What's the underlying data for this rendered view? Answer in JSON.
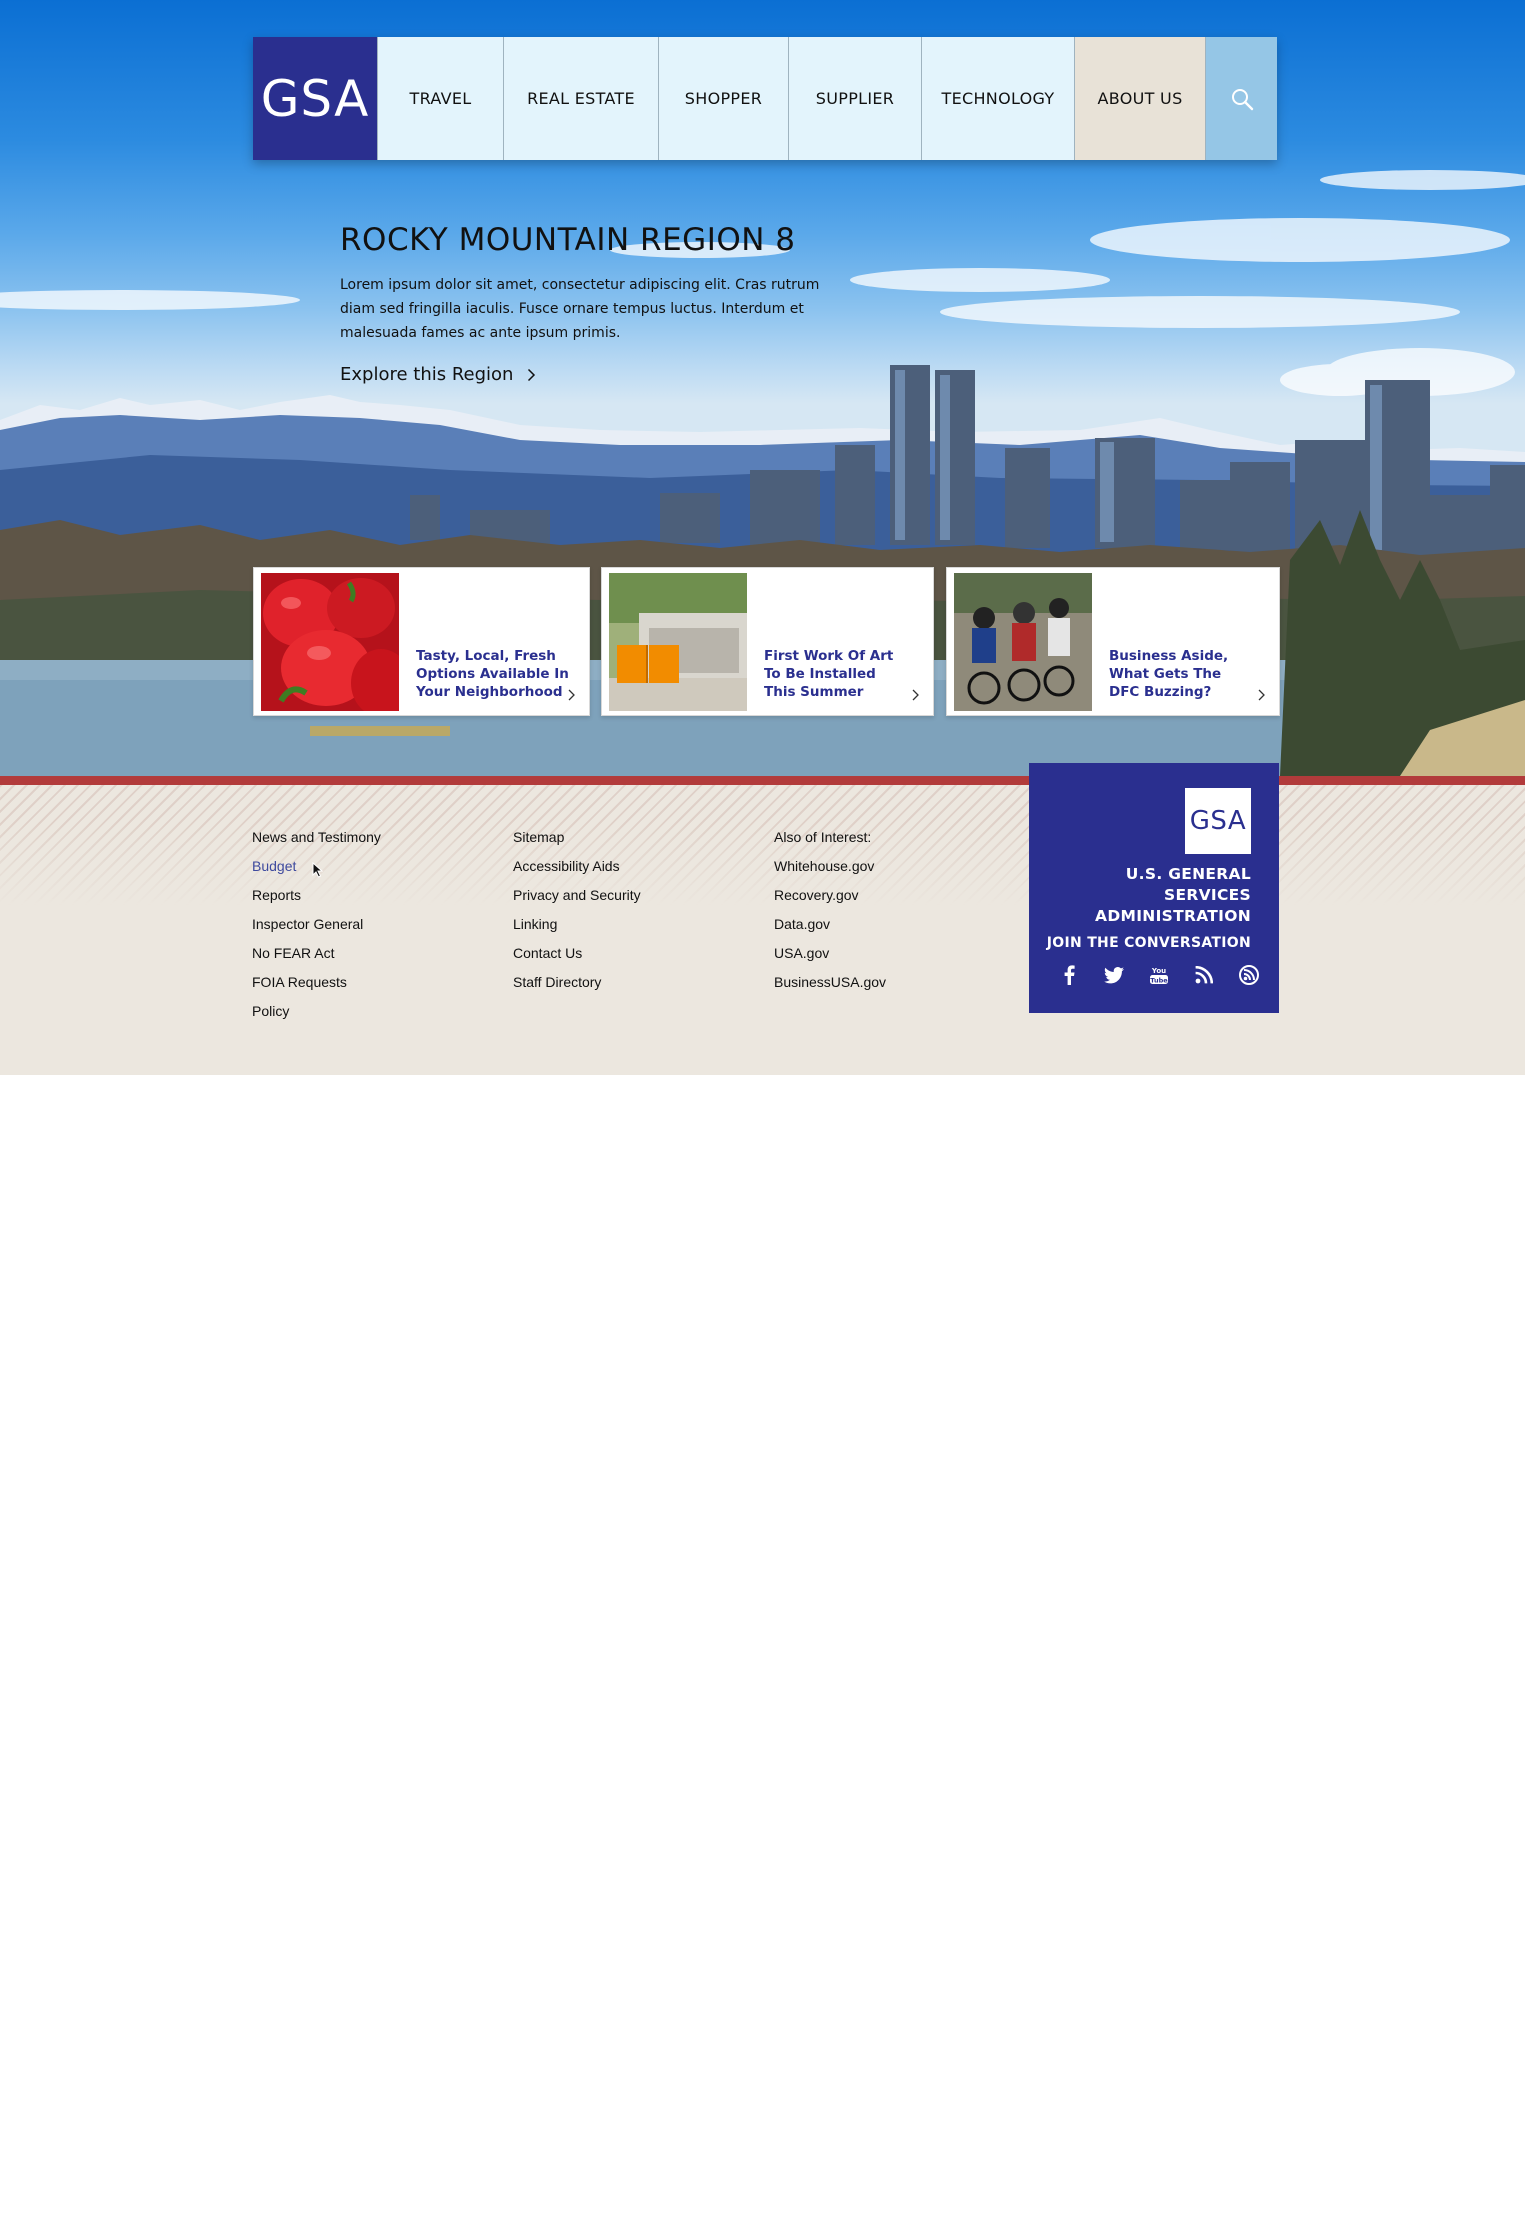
{
  "logo": {
    "text": "GSA"
  },
  "nav": {
    "items": [
      {
        "label": "TRAVEL"
      },
      {
        "label": "REAL ESTATE"
      },
      {
        "label": "SHOPPER"
      },
      {
        "label": "SUPPLIER"
      },
      {
        "label": "TECHNOLOGY"
      },
      {
        "label": "ABOUT US"
      }
    ],
    "search_icon": "search-icon"
  },
  "hero": {
    "title": "ROCKY MOUNTAIN REGION 8",
    "description": "Lorem ipsum dolor sit amet, consectetur adipiscing elit. Cras rutrum diam sed fringilla iaculis. Fusce ornare tempus luctus. Interdum et malesuada fames ac ante ipsum primis.",
    "link": "Explore this Region"
  },
  "cards": [
    {
      "text": "Tasty, Local, Fresh Options Available In Your Neighborhood",
      "image": "red-peppers"
    },
    {
      "text": "First Work Of Art To Be Installed This Summer",
      "image": "art-installation"
    },
    {
      "text": "Business Aside, What Gets The DFC Buzzing?",
      "image": "cyclists"
    }
  ],
  "footer": {
    "col1": [
      "News and Testimony",
      "Budget",
      "Reports",
      "Inspector General",
      "No FEAR Act",
      "FOIA Requests",
      "Policy"
    ],
    "col2": [
      "Sitemap",
      "Accessibility Aids",
      "Privacy and Security",
      "Linking",
      "Contact Us",
      "Staff Directory"
    ],
    "col3": [
      "Also of Interest:",
      "Whitehouse.gov",
      "Recovery.gov",
      "Data.gov",
      "USA.gov",
      "BusinessUSA.gov"
    ],
    "active_link": "Budget",
    "box": {
      "logo_text": "GSA",
      "agency_line1": "U.S. GENERAL SERVICES",
      "agency_line2": "ADMINISTRATION",
      "join": "JOIN THE CONVERSATION",
      "socials": [
        "facebook-icon",
        "twitter-icon",
        "youtube-icon",
        "rss-icon",
        "blog-icon"
      ]
    }
  },
  "colors": {
    "brand_navy": "#2a2f8f",
    "nav_bg": "#e3f4fc",
    "nav_about_bg": "#e8e2d7",
    "search_bg": "#95c6e6",
    "footer_bg": "#ece7df",
    "accent_red": "#b23b3b"
  }
}
